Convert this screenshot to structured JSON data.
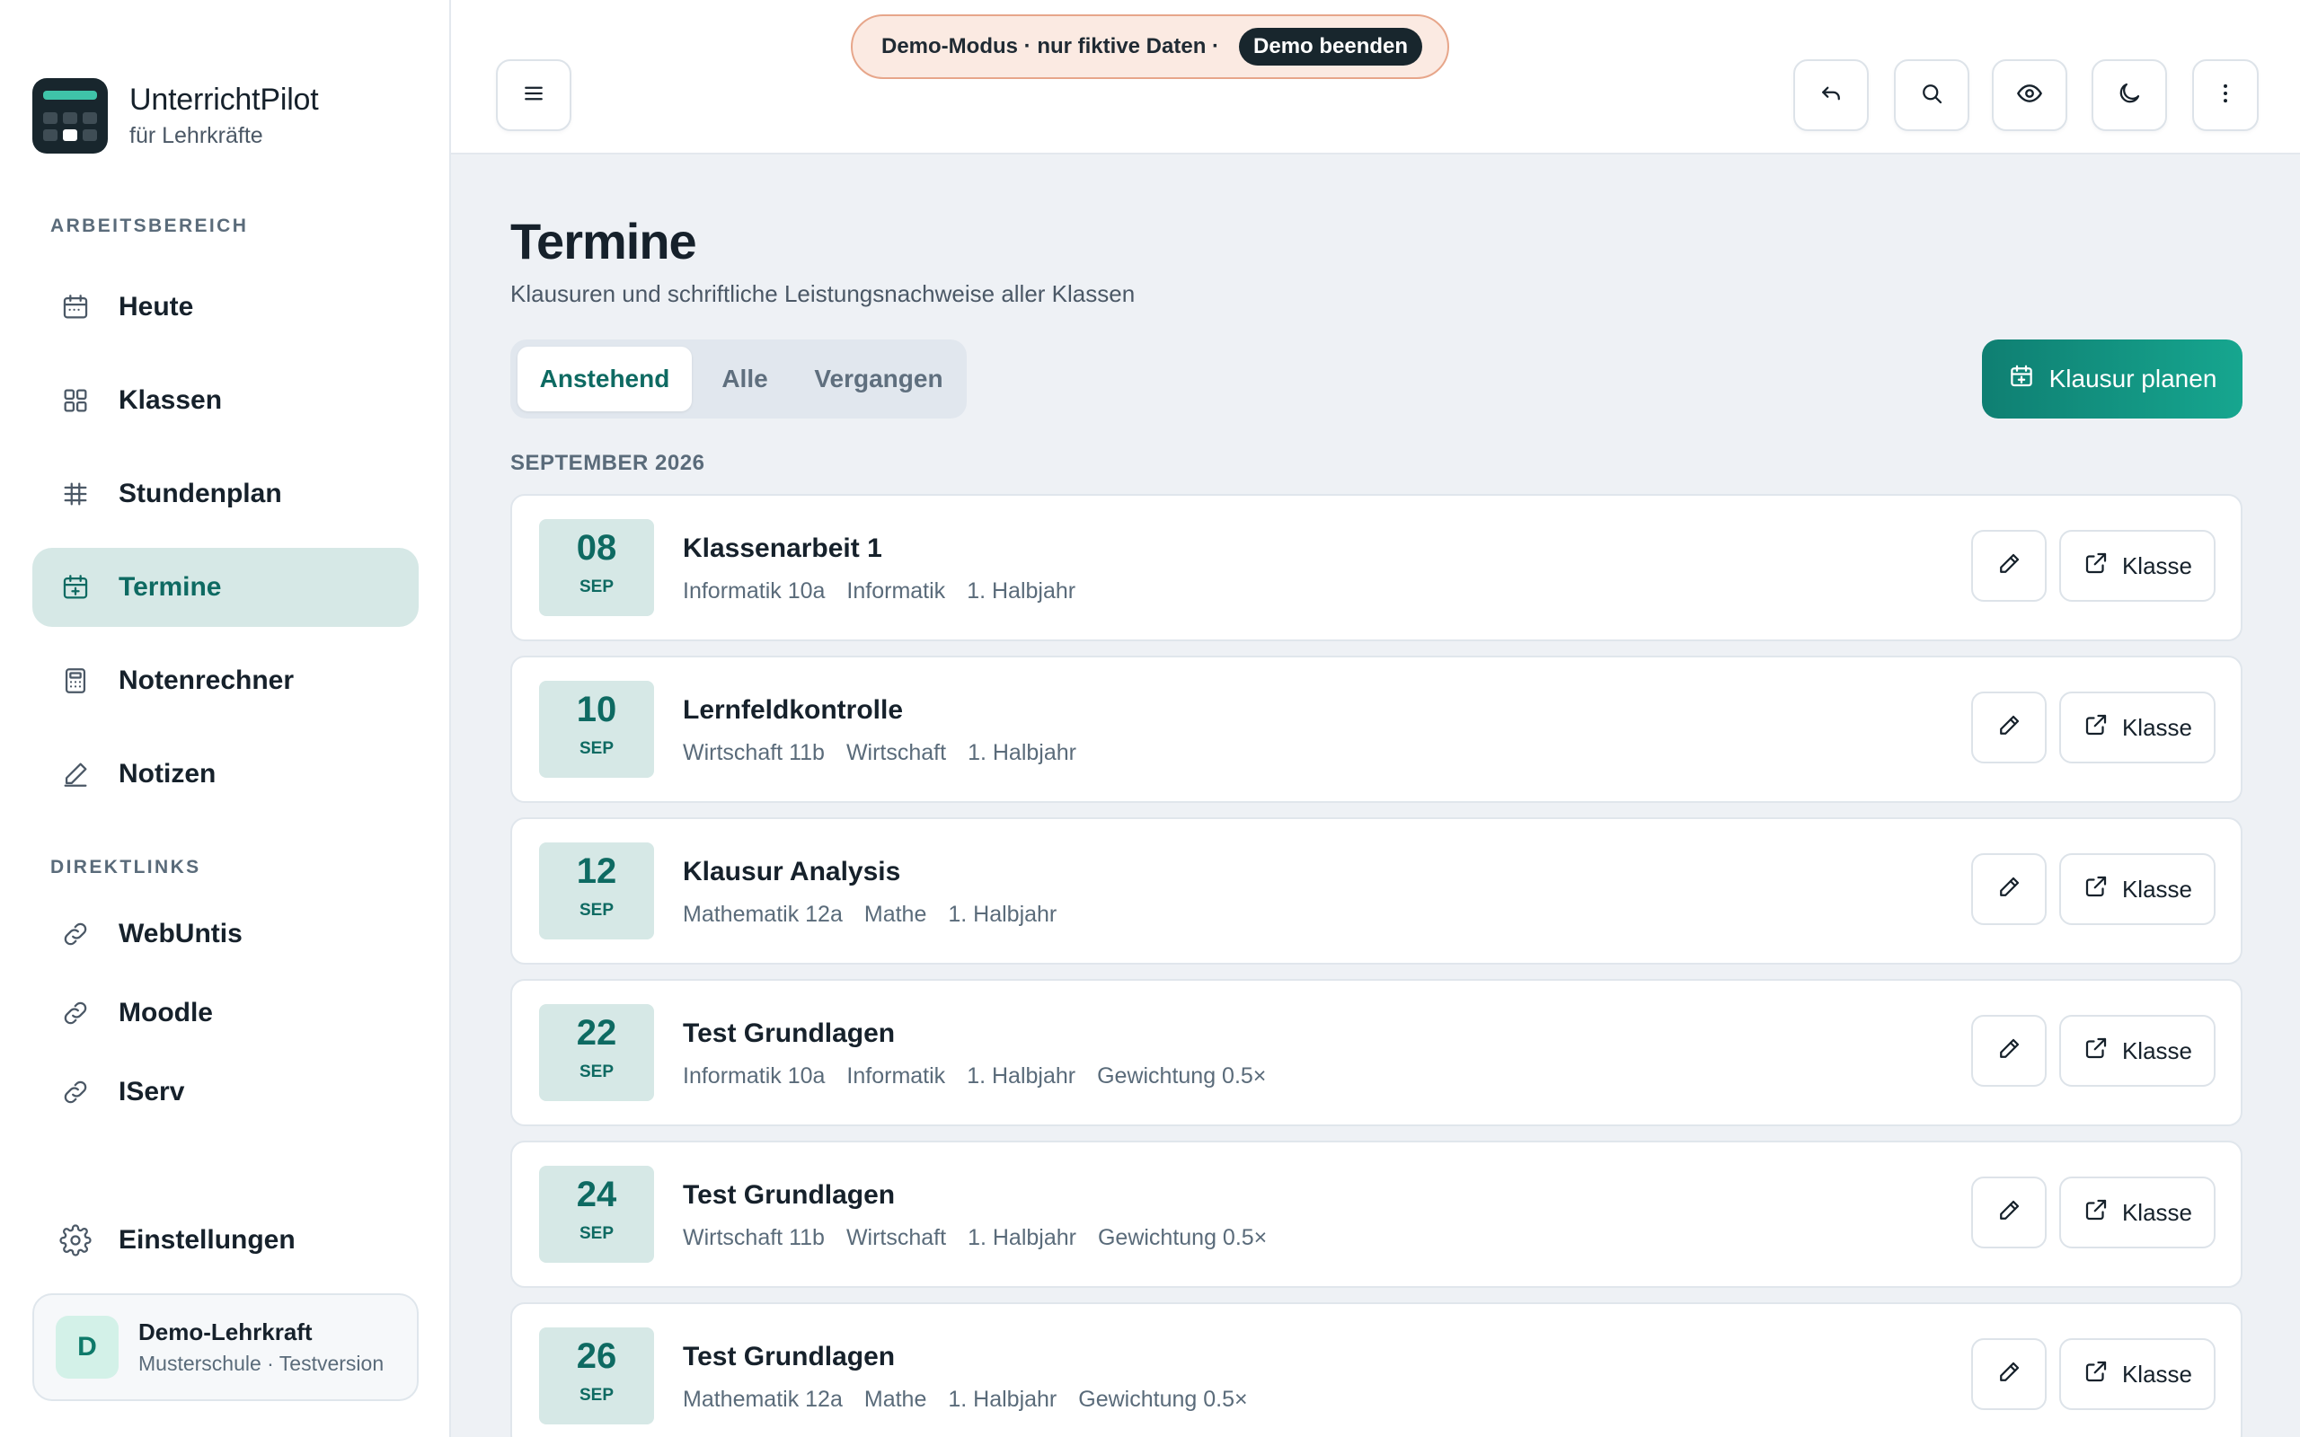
{
  "brand": {
    "title": "UnterrichtPilot",
    "subtitle": "für Lehrkräfte"
  },
  "sidebar": {
    "section_workspace": "ARBEITSBEREICH",
    "items": [
      {
        "label": "Heute",
        "icon": "calendar-icon"
      },
      {
        "label": "Klassen",
        "icon": "grid-icon"
      },
      {
        "label": "Stundenplan",
        "icon": "timetable-icon"
      },
      {
        "label": "Termine",
        "icon": "calendar-plus-icon",
        "active": true
      },
      {
        "label": "Notenrechner",
        "icon": "calculator-icon"
      },
      {
        "label": "Notizen",
        "icon": "pencil-icon"
      }
    ],
    "section_links": "DIREKTLINKS",
    "links": [
      {
        "label": "WebUntis",
        "icon": "link-icon"
      },
      {
        "label": "Moodle",
        "icon": "link-icon"
      },
      {
        "label": "IServ",
        "icon": "link-icon"
      }
    ],
    "settings": {
      "label": "Einstellungen",
      "icon": "gear-icon"
    },
    "user": {
      "initial": "D",
      "name": "Demo-Lehrkraft",
      "org": "Musterschule · Testversion"
    }
  },
  "topbar": {
    "menu_icon": "menu-icon",
    "demo_text": "Demo-Modus · nur fiktive Daten ·",
    "demo_end": "Demo beenden",
    "actions": [
      "undo-icon",
      "search-icon",
      "eye-icon",
      "moon-icon",
      "more-vertical-icon"
    ]
  },
  "page": {
    "title": "Termine",
    "subtitle": "Klausuren und schriftliche Leistungsnachweise aller Klassen",
    "tabs": [
      "Anstehend",
      "Alle",
      "Vergangen"
    ],
    "active_tab": "Anstehend",
    "primary_action": "Klausur planen",
    "month": "SEPTEMBER 2026"
  },
  "events": [
    {
      "day": "08",
      "month": "SEP",
      "title": "Klassenarbeit 1",
      "meta": [
        "Informatik 10a",
        "Informatik",
        "1. Halbjahr"
      ],
      "button": "Klasse"
    },
    {
      "day": "10",
      "month": "SEP",
      "title": "Lernfeldkontrolle",
      "meta": [
        "Wirtschaft 11b",
        "Wirtschaft",
        "1. Halbjahr"
      ],
      "button": "Klasse"
    },
    {
      "day": "12",
      "month": "SEP",
      "title": "Klausur Analysis",
      "meta": [
        "Mathematik 12a",
        "Mathe",
        "1. Halbjahr"
      ],
      "button": "Klasse"
    },
    {
      "day": "22",
      "month": "SEP",
      "title": "Test Grundlagen",
      "meta": [
        "Informatik 10a",
        "Informatik",
        "1. Halbjahr",
        "Gewichtung 0.5×"
      ],
      "button": "Klasse"
    },
    {
      "day": "24",
      "month": "SEP",
      "title": "Test Grundlagen",
      "meta": [
        "Wirtschaft 11b",
        "Wirtschaft",
        "1. Halbjahr",
        "Gewichtung 0.5×"
      ],
      "button": "Klasse"
    },
    {
      "day": "26",
      "month": "SEP",
      "title": "Test Grundlagen",
      "meta": [
        "Mathematik 12a",
        "Mathe",
        "1. Halbjahr",
        "Gewichtung 0.5×"
      ],
      "button": "Klasse"
    }
  ],
  "colors": {
    "accent": "#0e6a62",
    "accent_light": "#d6e8e6",
    "banner_bg": "#fbeae2",
    "banner_border": "#e7a68a"
  }
}
